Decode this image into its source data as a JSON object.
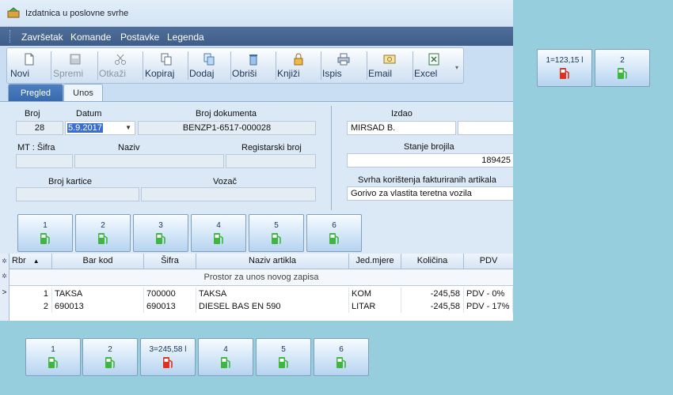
{
  "window": {
    "title": "Izdatnica u poslovne svrhe"
  },
  "menu": [
    "Završetak",
    "Komande",
    "Postavke",
    "Legenda"
  ],
  "toolbar": [
    {
      "label": "Novi",
      "icon": "new-document-icon",
      "enabled": true
    },
    {
      "label": "Spremi",
      "icon": "save-icon",
      "enabled": false
    },
    {
      "label": "Otkaži",
      "icon": "scissors-icon",
      "enabled": false
    },
    {
      "label": "Kopiraj",
      "icon": "copy-icon",
      "enabled": true
    },
    {
      "label": "Dodaj",
      "icon": "add-icon",
      "enabled": true
    },
    {
      "label": "Obriši",
      "icon": "trash-icon",
      "enabled": true
    },
    {
      "label": "Knjiži",
      "icon": "lock-icon",
      "enabled": true
    },
    {
      "label": "Ispis",
      "icon": "printer-icon",
      "enabled": true
    },
    {
      "label": "Email",
      "icon": "email-icon",
      "enabled": true
    },
    {
      "label": "Excel",
      "icon": "excel-icon",
      "enabled": true
    }
  ],
  "tabs": [
    {
      "label": "Pregled",
      "active": true
    },
    {
      "label": "Unos",
      "active": false
    }
  ],
  "form": {
    "broj_label": "Broj",
    "broj_value": "28",
    "datum_label": "Datum",
    "datum_value": "5.9.2017",
    "broj_dokumenta_label": "Broj dokumenta",
    "broj_dokumenta_value": "BENZP1-6517-000028",
    "mt_sifra_label": "MT : Šifra",
    "naziv_label": "Naziv",
    "registarski_broj_label": "Registarski broj",
    "broj_kartice_label": "Broj kartice",
    "vozac_label": "Vozač",
    "izdao_label": "Izdao",
    "izdao_value": "MIRSAD B.",
    "stanje_brojila_label": "Stanje brojila",
    "stanje_brojila_value": "189425",
    "svrha_label": "Svrha korištenja fakturiranih artikala",
    "svrha_value": "Gorivo za vlastita teretna vozila"
  },
  "pumps_main": [
    {
      "label": "1",
      "active": false
    },
    {
      "label": "2",
      "active": false
    },
    {
      "label": "3",
      "active": false
    },
    {
      "label": "4",
      "active": false
    },
    {
      "label": "5",
      "active": false
    },
    {
      "label": "6",
      "active": false
    }
  ],
  "pumps_top_right": [
    {
      "label": "1=123,15 l",
      "active": true
    },
    {
      "label": "2",
      "active": false
    }
  ],
  "pumps_bottom": [
    {
      "label": "1",
      "active": false
    },
    {
      "label": "2",
      "active": false
    },
    {
      "label": "3=245,58 l",
      "active": true
    },
    {
      "label": "4",
      "active": false
    },
    {
      "label": "5",
      "active": false
    },
    {
      "label": "6",
      "active": false
    }
  ],
  "grid": {
    "columns": [
      "Rbr",
      "Bar kod",
      "Šifra",
      "Naziv artikla",
      "Jed.mjere",
      "Količina",
      "PDV"
    ],
    "new_row_text": "Prostor za unos novog zapisa",
    "rows": [
      [
        "1",
        "TAKSA",
        "700000",
        "TAKSA",
        "KOM",
        "-245,58",
        "PDV - 0%"
      ],
      [
        "2",
        "690013",
        "690013",
        "DIESEL BAS EN 590",
        "LITAR",
        "-245,58",
        "PDV - 17%"
      ]
    ]
  },
  "colors": {
    "pump_idle": "#3fb63f",
    "pump_active": "#e0301e",
    "background": "#96cede",
    "menubar": "#3e5d88"
  }
}
